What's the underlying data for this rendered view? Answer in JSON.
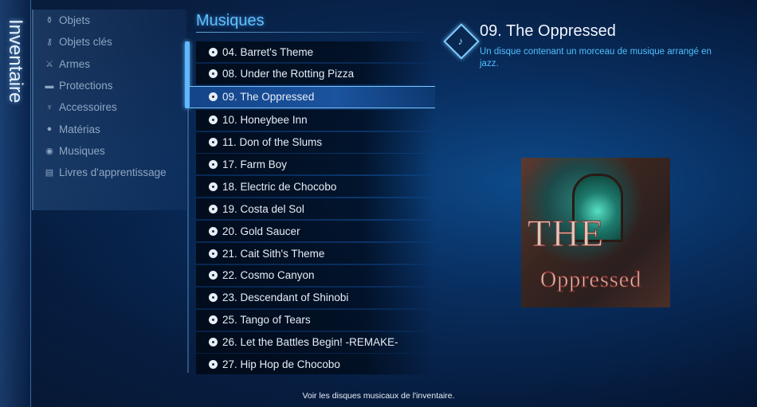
{
  "sidebar_title": "Inventaire",
  "categories": [
    {
      "label": "Objets",
      "icon": "potion-icon"
    },
    {
      "label": "Objets clés",
      "icon": "key-icon"
    },
    {
      "label": "Armes",
      "icon": "sword-icon"
    },
    {
      "label": "Protections",
      "icon": "armor-icon"
    },
    {
      "label": "Accessoires",
      "icon": "accessory-icon"
    },
    {
      "label": "Matérias",
      "icon": "materia-icon"
    },
    {
      "label": "Musiques",
      "icon": "music-icon"
    },
    {
      "label": "Livres d'apprentissage",
      "icon": "book-icon"
    }
  ],
  "section_title": "Musiques",
  "tracks": [
    "04. Barret's Theme",
    "08. Under the Rotting Pizza",
    "09. The Oppressed",
    "10. Honeybee Inn",
    "11. Don of the Slums",
    "17. Farm Boy",
    "18. Electric de Chocobo",
    "19. Costa del Sol",
    "20. Gold Saucer",
    "21. Cait Sith's Theme",
    "22. Cosmo Canyon",
    "23. Descendant of Shinobi",
    "25. Tango of Tears",
    "26. Let the Battles Begin! -REMAKE-",
    "27. Hip Hop de Chocobo"
  ],
  "selected_index": 2,
  "detail": {
    "title": "09. The Oppressed",
    "description": "Un disque contenant un morceau de musique arrangé en jazz.",
    "art_text_1": "THE",
    "art_text_2": "Oppressed"
  },
  "help_text": "Voir les disques musicaux de l'inventaire.",
  "colors": {
    "accent": "#5fc2ff",
    "description": "#4fc0ff",
    "selected_row": "#1e5aa8"
  }
}
